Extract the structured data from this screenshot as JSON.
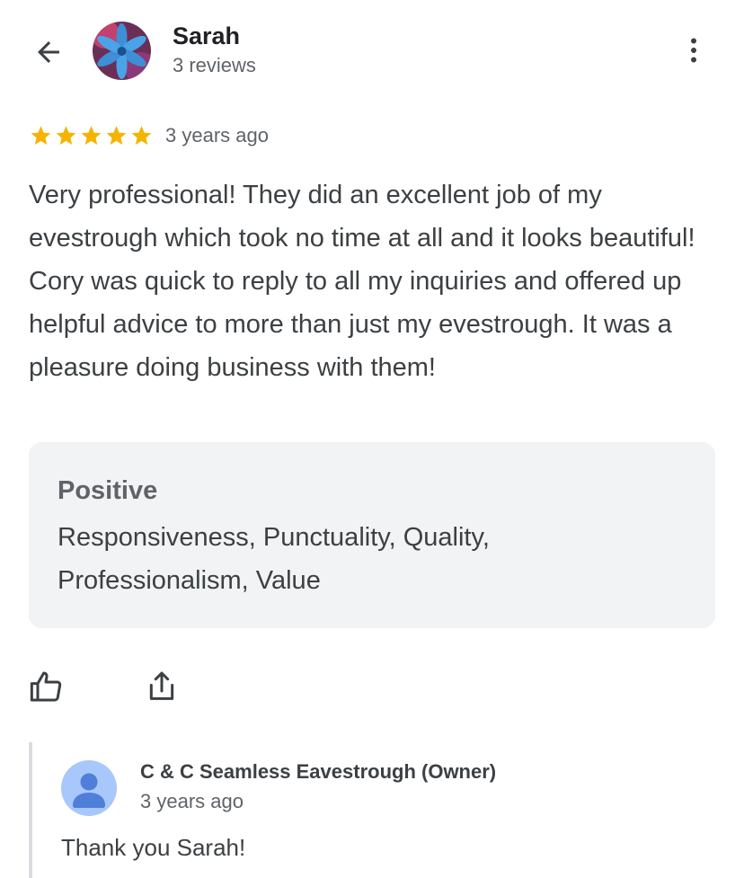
{
  "header": {
    "reviewer_name": "Sarah",
    "reviewer_meta": "3 reviews",
    "back_icon": "arrow-left-icon",
    "more_icon": "more-vert-icon"
  },
  "review": {
    "rating": 5,
    "rating_max": 5,
    "star_color": "#f4b400",
    "time": "3 years ago",
    "text": "Very professional! They did an excellent job of my evestrough which took no time at all and it looks beautiful! Cory was quick to reply to all my inquiries and offered up helpful advice to more than just my evestrough. It was a pleasure doing business with them!"
  },
  "attributes": {
    "title": "Positive",
    "list": "Responsiveness, Punctuality, Quality, Professionalism, Value"
  },
  "actions": {
    "like_icon": "thumb-up-icon",
    "share_icon": "share-icon"
  },
  "owner_reply": {
    "name": "C & C Seamless Eavestrough (Owner)",
    "time": "3 years ago",
    "text": "Thank you Sarah!"
  }
}
